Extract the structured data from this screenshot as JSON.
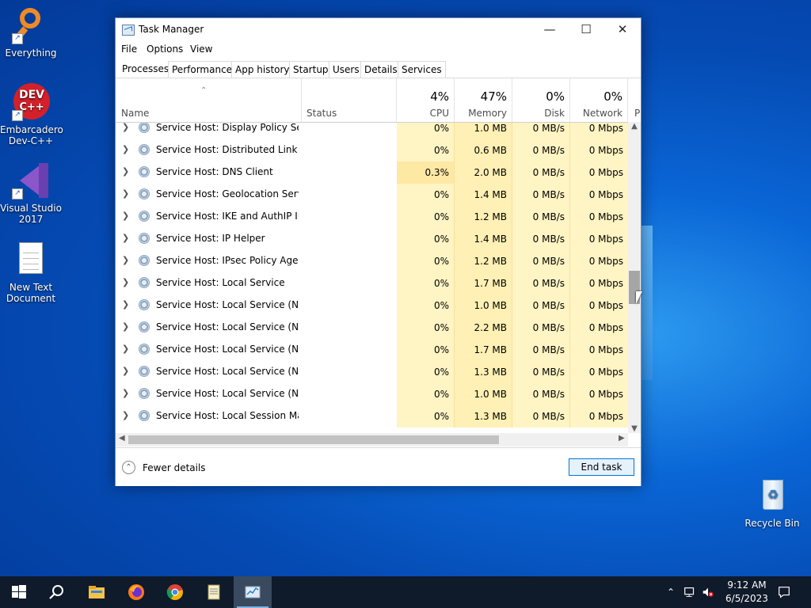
{
  "desktop": {
    "icons": [
      {
        "label_line1": "Everything",
        "label_line2": ""
      },
      {
        "label_line1": "Embarcadero",
        "label_line2": "Dev-C++"
      },
      {
        "label_line1": "Visual Studio",
        "label_line2": "2017"
      },
      {
        "label_line1": "New Text",
        "label_line2": "Document"
      },
      {
        "label_line1": "Recycle Bin",
        "label_line2": ""
      }
    ],
    "devcpp_logo_top": "DEV",
    "devcpp_logo_bottom": "C++"
  },
  "window": {
    "title": "Task Manager",
    "minimize": "—",
    "maximize": "☐",
    "close": "✕",
    "menu": [
      "File",
      "Options",
      "View"
    ],
    "tabs": [
      "Processes",
      "Performance",
      "App history",
      "Startup",
      "Users",
      "Details",
      "Services"
    ],
    "active_tab": "Processes",
    "columns": {
      "name": "Name",
      "status": "Status",
      "cpu": {
        "pct": "4%",
        "label": "CPU"
      },
      "memory": {
        "pct": "47%",
        "label": "Memory"
      },
      "disk": {
        "pct": "0%",
        "label": "Disk"
      },
      "network": {
        "pct": "0%",
        "label": "Network"
      },
      "power_partial": "P"
    },
    "rows": [
      {
        "name": "Service Host: Display Policy Serv...",
        "cpu": "0%",
        "memory": "1.0 MB",
        "disk": "0 MB/s",
        "network": "0 Mbps"
      },
      {
        "name": "Service Host: Distributed Link Tr...",
        "cpu": "0%",
        "memory": "0.6 MB",
        "disk": "0 MB/s",
        "network": "0 Mbps"
      },
      {
        "name": "Service Host: DNS Client",
        "cpu": "0.3%",
        "memory": "2.0 MB",
        "disk": "0 MB/s",
        "network": "0 Mbps"
      },
      {
        "name": "Service Host: Geolocation Service",
        "cpu": "0%",
        "memory": "1.4 MB",
        "disk": "0 MB/s",
        "network": "0 Mbps"
      },
      {
        "name": "Service Host: IKE and AuthIP IPs...",
        "cpu": "0%",
        "memory": "1.2 MB",
        "disk": "0 MB/s",
        "network": "0 Mbps"
      },
      {
        "name": "Service Host: IP Helper",
        "cpu": "0%",
        "memory": "1.4 MB",
        "disk": "0 MB/s",
        "network": "0 Mbps"
      },
      {
        "name": "Service Host: IPsec Policy Agent",
        "cpu": "0%",
        "memory": "1.2 MB",
        "disk": "0 MB/s",
        "network": "0 Mbps"
      },
      {
        "name": "Service Host: Local Service",
        "cpu": "0%",
        "memory": "1.7 MB",
        "disk": "0 MB/s",
        "network": "0 Mbps"
      },
      {
        "name": "Service Host: Local Service (Net...",
        "cpu": "0%",
        "memory": "1.0 MB",
        "disk": "0 MB/s",
        "network": "0 Mbps"
      },
      {
        "name": "Service Host: Local Service (Net...",
        "cpu": "0%",
        "memory": "2.2 MB",
        "disk": "0 MB/s",
        "network": "0 Mbps"
      },
      {
        "name": "Service Host: Local Service (Net...",
        "cpu": "0%",
        "memory": "1.7 MB",
        "disk": "0 MB/s",
        "network": "0 Mbps"
      },
      {
        "name": "Service Host: Local Service (Net...",
        "cpu": "0%",
        "memory": "1.3 MB",
        "disk": "0 MB/s",
        "network": "0 Mbps"
      },
      {
        "name": "Service Host: Local Service (No ...",
        "cpu": "0%",
        "memory": "1.0 MB",
        "disk": "0 MB/s",
        "network": "0 Mbps"
      },
      {
        "name": "Service Host: Local Session Man...",
        "cpu": "0%",
        "memory": "1.3 MB",
        "disk": "0 MB/s",
        "network": "0 Mbps"
      }
    ],
    "fewer_details": "Fewer details",
    "end_task": "End task"
  },
  "taskbar": {
    "apps": [
      "start-icon",
      "search-icon",
      "file-explorer-icon",
      "firefox-icon",
      "chrome-icon",
      "notepad-icon",
      "task-manager-icon"
    ],
    "time": "9:12 AM",
    "date": "6/5/2023"
  },
  "colors": {
    "accent": "#0078d7",
    "heat_light": "#fff4c4",
    "heat_medium": "#fde8a4",
    "taskbar": "#0f1a2a"
  }
}
